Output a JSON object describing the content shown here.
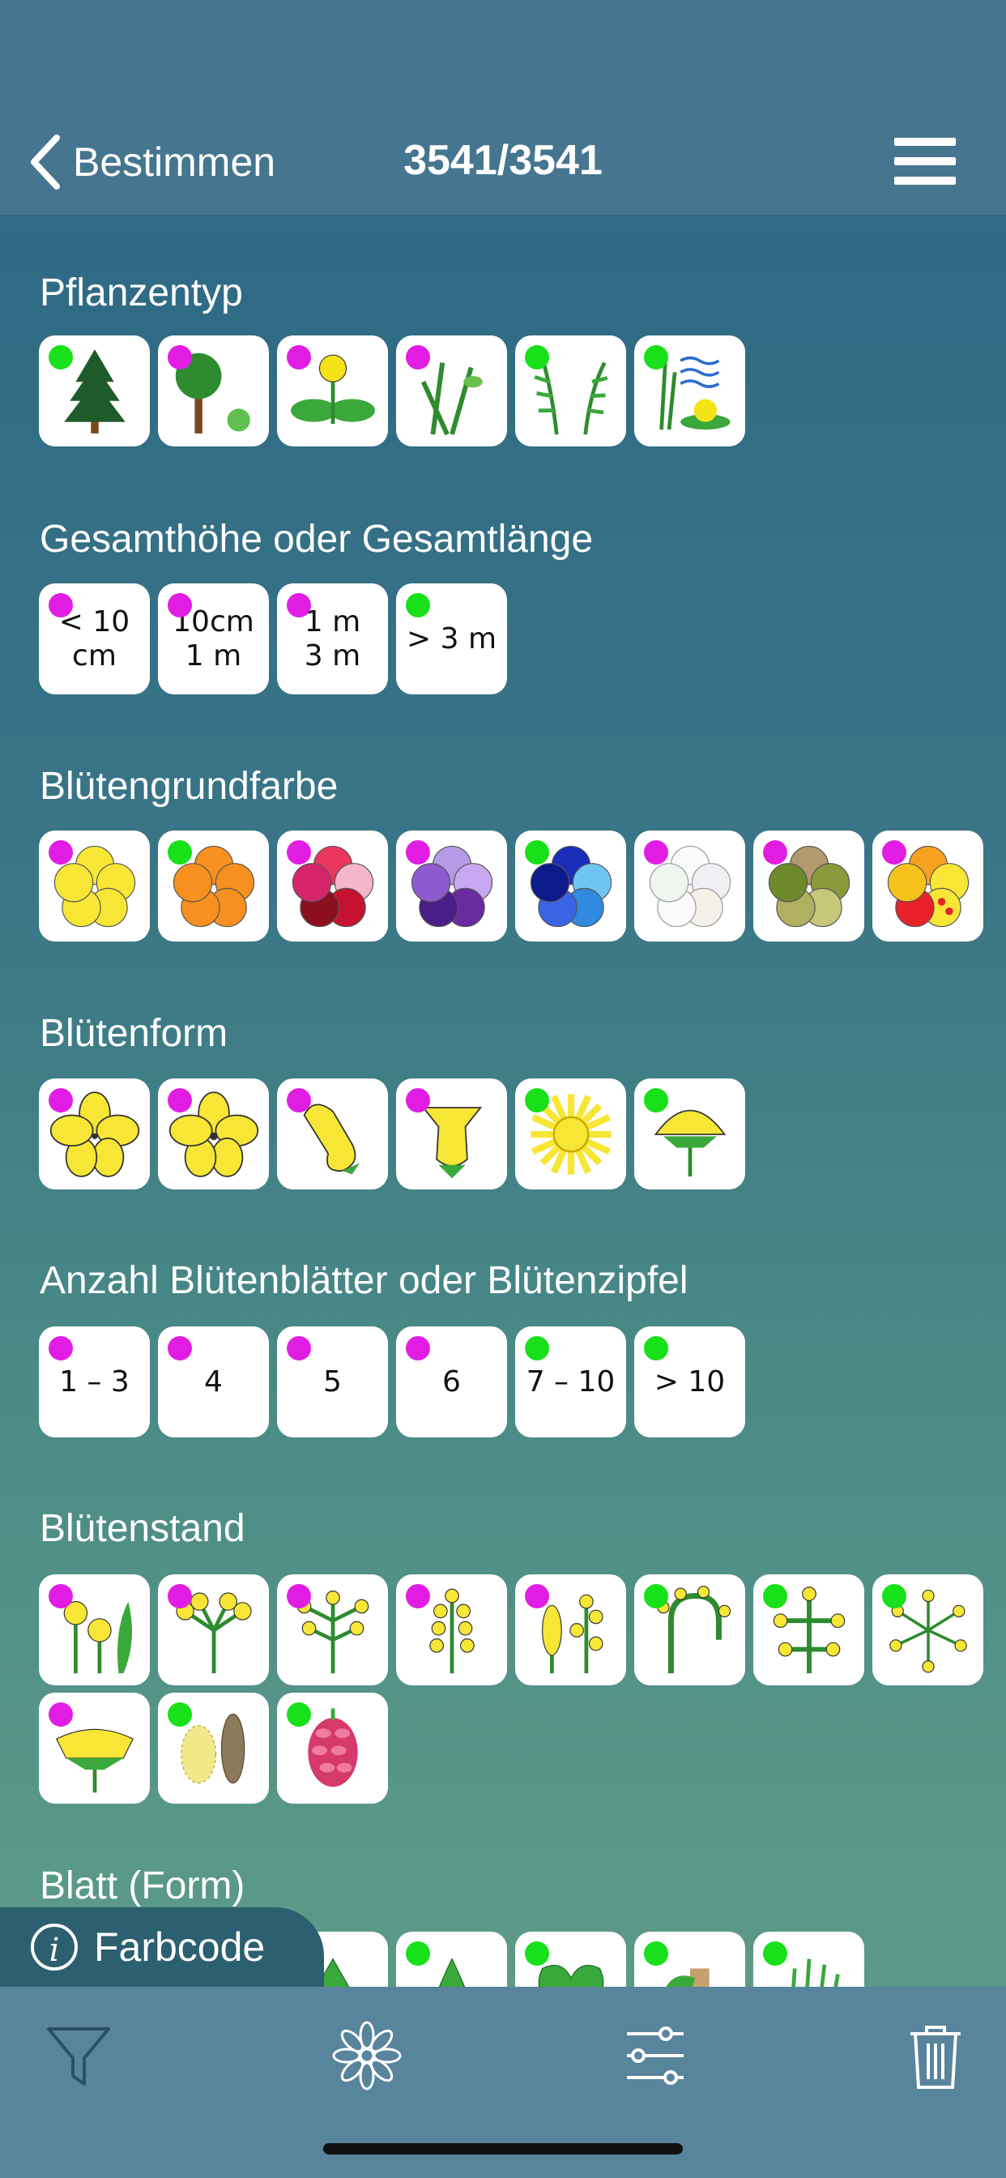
{
  "nav": {
    "back_label": "Bestimmen",
    "count": "3541/3541"
  },
  "sections": {
    "pflanzentyp": {
      "title": "Pflanzentyp"
    },
    "hoehe": {
      "title": "Gesamthöhe oder Gesamtlänge",
      "options": [
        {
          "line1": "< 10",
          "line2": "cm"
        },
        {
          "line1": "10cm",
          "line2": "1 m"
        },
        {
          "line1": "1 m",
          "line2": "3 m"
        },
        {
          "line1": "> 3 m",
          "line2": ""
        }
      ]
    },
    "farbe": {
      "title": "Blütengrundfarbe"
    },
    "form": {
      "title": "Blütenform"
    },
    "anzahl": {
      "title": "Anzahl Blütenblätter oder Blütenzipfel",
      "options": [
        "1 – 3",
        "4",
        "5",
        "6",
        "7 – 10",
        "> 10"
      ]
    },
    "stand": {
      "title": "Blütenstand"
    },
    "blatt": {
      "title": "Blatt (Form)"
    }
  },
  "legend": {
    "farbcode_label": "Farbcode",
    "magenta": "#e21de3",
    "green": "#18e01a"
  },
  "tabs": [
    "filter-icon",
    "flower-icon",
    "sliders-icon",
    "trash-icon"
  ]
}
